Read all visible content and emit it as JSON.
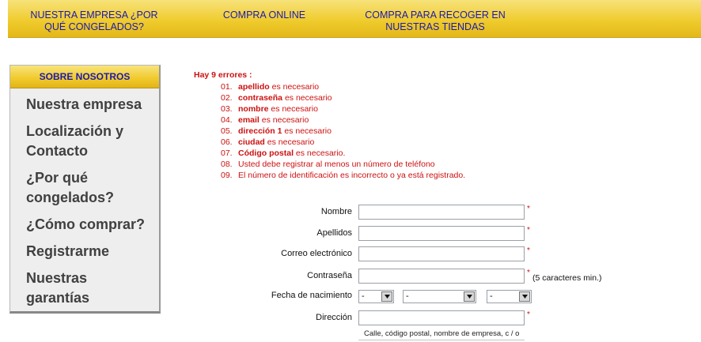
{
  "nav": {
    "items": [
      {
        "label": "NUESTRA EMPRESA ¿POR\nQUÉ CONGELADOS?"
      },
      {
        "label": "COMPRA ONLINE"
      },
      {
        "label": "COMPRA PARA RECOGER EN\nNUESTRAS TIENDAS"
      }
    ]
  },
  "sidebar": {
    "header": "SOBRE NOSOTROS",
    "items": [
      {
        "label": "Nuestra empresa"
      },
      {
        "label": "Localización y\nContacto"
      },
      {
        "label": "¿Por qué\ncongelados?"
      },
      {
        "label": "¿Cómo comprar?"
      },
      {
        "label": "Registrarme"
      },
      {
        "label": "Nuestras\ngarantías"
      }
    ]
  },
  "errors": {
    "title": "Hay 9 errores :",
    "items": [
      {
        "num": "01.",
        "strong": "apellido",
        "text": " es necesario"
      },
      {
        "num": "02.",
        "strong": "contraseña",
        "text": " es necesario"
      },
      {
        "num": "03.",
        "strong": "nombre",
        "text": " es necesario"
      },
      {
        "num": "04.",
        "strong": "email",
        "text": " es necesario"
      },
      {
        "num": "05.",
        "strong": "dirección 1",
        "text": " es necesario"
      },
      {
        "num": "06.",
        "strong": "ciudad",
        "text": " es necesario"
      },
      {
        "num": "07.",
        "strong": "Código postal",
        "text": " es necesario."
      },
      {
        "num": "08.",
        "strong": "",
        "text": "Usted debe registrar al menos un número de teléfono"
      },
      {
        "num": "09.",
        "strong": "",
        "text": "El número de identificación es incorrecto o ya está registrado."
      }
    ]
  },
  "form": {
    "nombre_label": "Nombre",
    "nombre_value": "",
    "apellidos_label": "Apellidos",
    "apellidos_value": "",
    "email_label": "Correo electrónico",
    "email_value": "",
    "password_label": "Contraseña",
    "password_value": "",
    "password_hint": "(5 caracteres min.)",
    "birth_label": "Fecha de nacimiento",
    "birth_day": "-",
    "birth_month": "-",
    "birth_year": "-",
    "address_label": "Dirección",
    "address_value": "",
    "address_hint": "Calle, código postal, nombre de empresa, c / o",
    "required_mark": "*"
  },
  "colors": {
    "accent_yellow": "#f0cc2e",
    "nav_text": "#1a1ab0",
    "error_red": "#cc1111",
    "sidebar_text": "#404040"
  }
}
